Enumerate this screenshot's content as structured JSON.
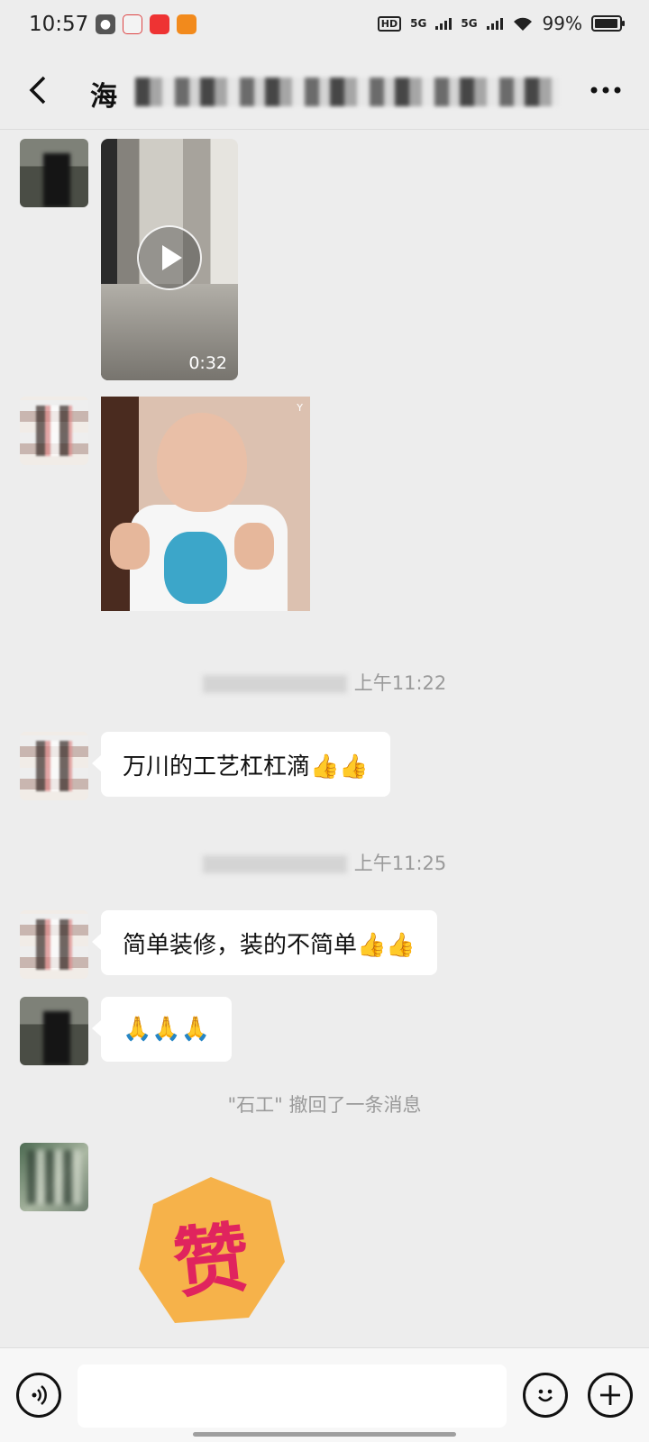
{
  "status_bar": {
    "time": "10:57",
    "network_1": "5G",
    "network_2": "5G",
    "hd": "HD",
    "battery": "99%"
  },
  "header": {
    "title": "海",
    "back_icon": "chevron-left-icon",
    "more_icon": "more-dots-icon"
  },
  "messages": {
    "video_duration": "0:32",
    "gif_mark": "Y",
    "ts1": "上午11:22",
    "msg1": "万川的工艺杠杠滴👍👍",
    "ts2": "上午11:25",
    "msg2": "简单装修，装的不简单👍👍",
    "msg3": "🙏🙏🙏",
    "system_notice": "\"石工\" 撤回了一条消息",
    "sticker_text": "赞"
  },
  "input_bar": {
    "voice_icon": "voice-icon",
    "emoji_icon": "emoji-icon",
    "add_icon": "plus-icon",
    "placeholder": ""
  },
  "colors": {
    "background": "#ededed",
    "bubble": "#ffffff",
    "sticker_bg": "#f6b24a",
    "sticker_text": "#e0245e"
  }
}
